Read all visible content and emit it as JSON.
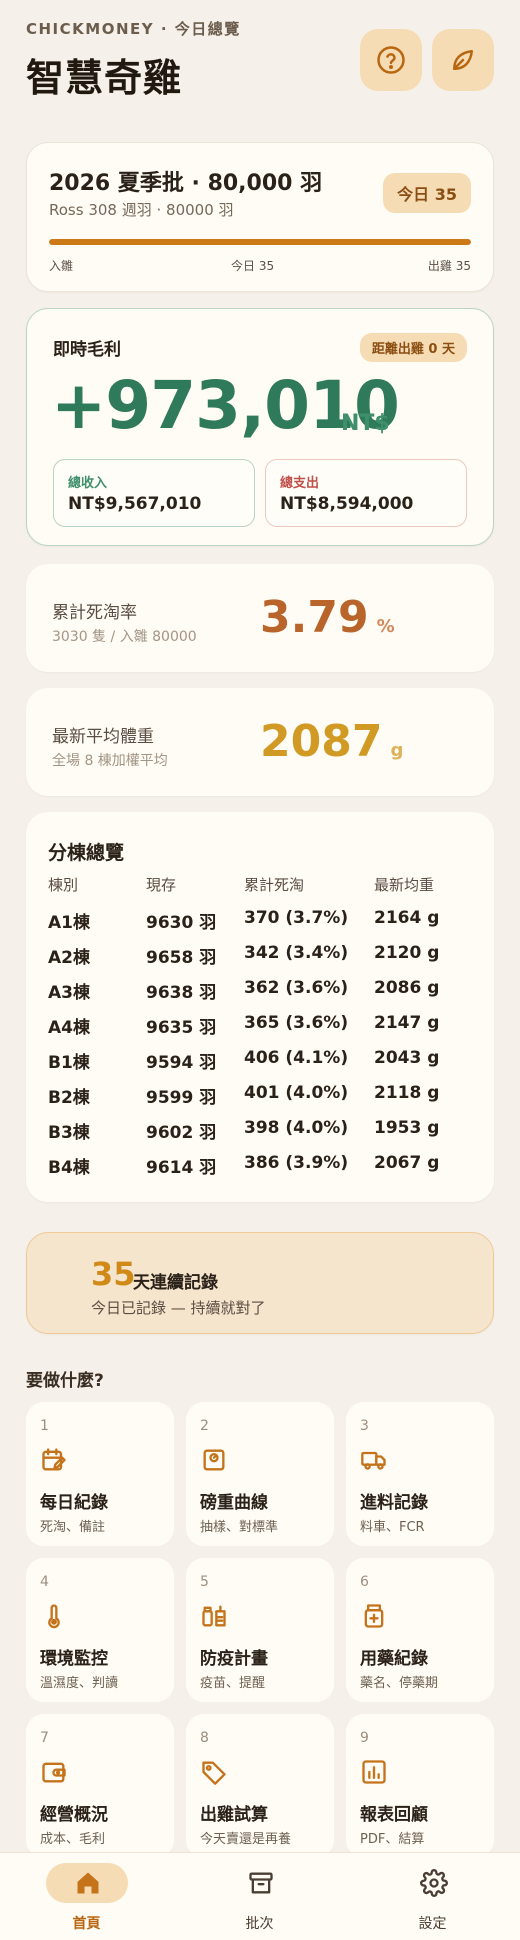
{
  "header": {
    "eyebrow": "CHICKMONEY · 今日總覽",
    "title": "智慧奇雞"
  },
  "batch": {
    "title": "2026 夏季批 · 80,000 羽",
    "subtitle": "Ross 308 週羽 · 80000 羽",
    "day_badge": "今日 35",
    "progress_fraction": 1.0,
    "start_label": "入雛",
    "today_label": "今日 35",
    "end_label": "出雞 35"
  },
  "profit": {
    "label": "即時毛利",
    "countdown": "距離出雞 0 天",
    "value": "+973,010",
    "currency": "NT$",
    "income_label": "總收入",
    "income_value": "NT$9,567,010",
    "expense_label": "總支出",
    "expense_value": "NT$8,594,000"
  },
  "mortality": {
    "label": "累計死淘率",
    "sub": "3030 隻 / 入雛 80000",
    "value": "3.79",
    "unit": "%"
  },
  "weight": {
    "label": "最新平均體重",
    "sub": "全場 8 棟加權平均",
    "value": "2087",
    "unit": "g"
  },
  "houses": {
    "title": "分棟總覽",
    "headers": [
      "棟別",
      "現存",
      "累計死淘",
      "最新均重"
    ],
    "rows": [
      [
        "A1棟",
        "9630 羽",
        "370 (3.7%)",
        "2164 g"
      ],
      [
        "A2棟",
        "9658 羽",
        "342 (3.4%)",
        "2120 g"
      ],
      [
        "A3棟",
        "9638 羽",
        "362 (3.6%)",
        "2086 g"
      ],
      [
        "A4棟",
        "9635 羽",
        "365 (3.6%)",
        "2147 g"
      ],
      [
        "B1棟",
        "9594 羽",
        "406 (4.1%)",
        "2043 g"
      ],
      [
        "B2棟",
        "9599 羽",
        "401 (4.0%)",
        "2118 g"
      ],
      [
        "B3棟",
        "9602 羽",
        "398 (4.0%)",
        "1953 g"
      ],
      [
        "B4棟",
        "9614 羽",
        "386 (3.9%)",
        "2067 g"
      ]
    ]
  },
  "streak": {
    "days": "35",
    "title": "天連續記錄",
    "sub": "今日已記錄 — 持續就對了"
  },
  "actions_title": "要做什麼?",
  "tiles": [
    {
      "n": "1",
      "title": "每日紀錄",
      "sub": "死淘、備註",
      "icon": "calendar-edit-icon"
    },
    {
      "n": "2",
      "title": "磅重曲線",
      "sub": "抽樣、對標準",
      "icon": "scale-icon"
    },
    {
      "n": "3",
      "title": "進料記錄",
      "sub": "料車、FCR",
      "icon": "truck-icon"
    },
    {
      "n": "4",
      "title": "環境監控",
      "sub": "溫濕度、判讀",
      "icon": "thermometer-icon"
    },
    {
      "n": "5",
      "title": "防疫計畫",
      "sub": "疫苗、提醒",
      "icon": "vaccine-icon"
    },
    {
      "n": "6",
      "title": "用藥紀錄",
      "sub": "藥名、停藥期",
      "icon": "medicine-icon"
    },
    {
      "n": "7",
      "title": "經營概況",
      "sub": "成本、毛利",
      "icon": "wallet-icon"
    },
    {
      "n": "8",
      "title": "出雞試算",
      "sub": "今天賣還是再養",
      "icon": "tag-icon"
    },
    {
      "n": "9",
      "title": "報表回顧",
      "sub": "PDF、結算",
      "icon": "chart-icon"
    }
  ],
  "nav": [
    {
      "label": "首頁",
      "icon": "home-icon",
      "active": true
    },
    {
      "label": "批次",
      "icon": "archive-icon",
      "active": false
    },
    {
      "label": "設定",
      "icon": "gear-icon",
      "active": false
    }
  ],
  "colors": {
    "accent": "#cb7a17",
    "profit": "#2e7a5a",
    "mortality": "#b8642a",
    "weight": "#d19a24",
    "income": "#3f8f6c",
    "expense": "#c0504a"
  }
}
